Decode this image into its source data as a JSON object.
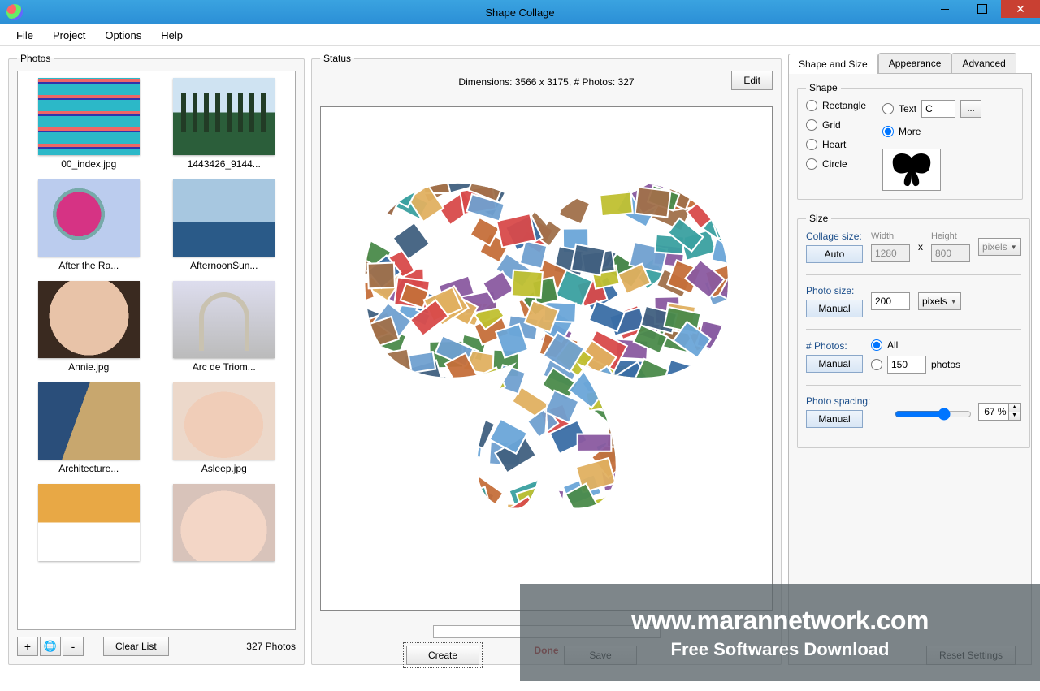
{
  "window": {
    "title": "Shape Collage"
  },
  "menu": {
    "file": "File",
    "project": "Project",
    "options": "Options",
    "help": "Help"
  },
  "photos_panel": {
    "legend": "Photos",
    "clear_list": "Clear List",
    "count_text": "327 Photos",
    "add_tip": "+",
    "remove_tip": "-",
    "thumbs": [
      {
        "name": "00_index.jpg",
        "class": "timg-grid"
      },
      {
        "name": "1443426_9144...",
        "class": "timg-trees"
      },
      {
        "name": "After the Ra...",
        "class": "timg-flower"
      },
      {
        "name": "AfternoonSun...",
        "class": "timg-sea"
      },
      {
        "name": "Annie.jpg",
        "class": "timg-face"
      },
      {
        "name": "Arc de Triom...",
        "class": "timg-arch"
      },
      {
        "name": "Architecture...",
        "class": "timg-building"
      },
      {
        "name": "Asleep.jpg",
        "class": "timg-baby"
      },
      {
        "name": "",
        "class": "timg-autumn"
      },
      {
        "name": "",
        "class": "timg-baby2"
      }
    ]
  },
  "status_panel": {
    "legend": "Status",
    "dimensions_text": "Dimensions: 3566 x 3175, # Photos: 327",
    "edit": "Edit",
    "done": "Done"
  },
  "settings": {
    "tabs": {
      "shape_size": "Shape and Size",
      "appearance": "Appearance",
      "advanced": "Advanced"
    },
    "shape": {
      "legend": "Shape",
      "rectangle": "Rectangle",
      "grid": "Grid",
      "heart": "Heart",
      "circle": "Circle",
      "text": "Text",
      "text_value": "C",
      "browse": "...",
      "more": "More",
      "selected": "more"
    },
    "size": {
      "legend": "Size",
      "collage_size_lbl": "Collage size:",
      "collage_mode": "Auto",
      "width_lbl": "Width",
      "width_val": "1280",
      "height_lbl": "Height",
      "height_val": "800",
      "x_sep": "x",
      "collage_unit": "pixels",
      "photo_size_lbl": "Photo size:",
      "photo_size_mode": "Manual",
      "photo_size_val": "200",
      "photo_size_unit": "pixels",
      "num_photos_lbl": "# Photos:",
      "num_photos_mode": "Manual",
      "all": "All",
      "num_photos_val": "150",
      "photos_unit": "photos",
      "spacing_lbl": "Photo spacing:",
      "spacing_mode": "Manual",
      "spacing_val": "67 %"
    }
  },
  "actions": {
    "create": "Create",
    "save": "Save",
    "reset": "Reset Settings"
  },
  "watermark": {
    "url": "www.marannetwork.com",
    "sub": "Free Softwares Download"
  }
}
